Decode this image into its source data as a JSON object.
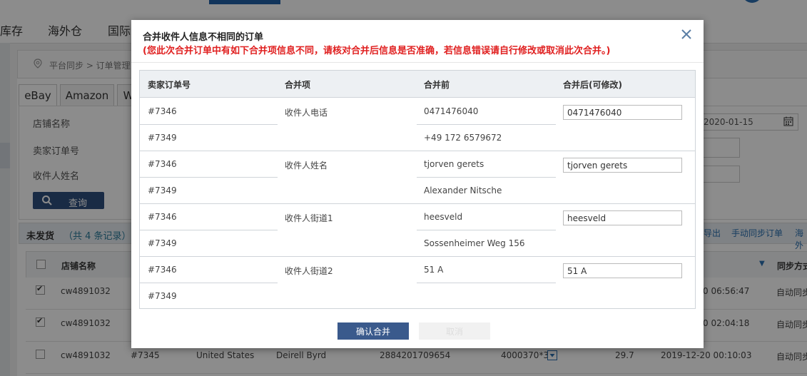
{
  "background": {
    "nav": [
      "库存",
      "海外仓",
      "国际"
    ],
    "breadcrumb": "平台同步 > 订单管理",
    "tabs": [
      "eBay",
      "Amazon",
      "W"
    ],
    "filters": [
      "店铺名称",
      "卖家订单号",
      "收件人姓名"
    ],
    "date_value": "2020-01-15",
    "search_label": "查询",
    "list_title": "未发货",
    "list_count": "（共 4 条记录）",
    "links": [
      "导出",
      "手动同步订单",
      "海外"
    ],
    "grid_headers": {
      "store": "店铺名称",
      "sync_method": "同步方式"
    },
    "rows": [
      {
        "checked": true,
        "store": "cw4891032",
        "time": "0 06:56:47",
        "sync": "自动同步"
      },
      {
        "checked": true,
        "store": "cw4891032",
        "time": "0 02:04:18",
        "sync": "自动同步"
      },
      {
        "checked": false,
        "store": "cw4891032",
        "order": "#7345",
        "country": "United States",
        "name": "Deirell Byrd",
        "phone": "2884201709654",
        "sku": "4000370*3",
        "amount": "29.7",
        "time": "2019-12-20 00:10:03",
        "sync": "自动同步"
      }
    ]
  },
  "modal": {
    "title": "合并收件人信息不相同的订单",
    "warning": "(您此次合并订单中有如下合并项信息不同，请核对合并后信息是否准确，若信息错误请自行修改或取消此次合并。)",
    "headers": [
      "卖家订单号",
      "合并项",
      "合并前",
      "合并后(可修改)"
    ],
    "groups": [
      {
        "orders": [
          "#7346",
          "#7349"
        ],
        "field": "收件人电话",
        "before": [
          "0471476040",
          "+49 172 6579672"
        ],
        "after": "0471476040"
      },
      {
        "orders": [
          "#7346",
          "#7349"
        ],
        "field": "收件人姓名",
        "before": [
          "tjorven gerets",
          "Alexander Nitsche"
        ],
        "after": "tjorven gerets"
      },
      {
        "orders": [
          "#7346",
          "#7349"
        ],
        "field": "收件人街道1",
        "before": [
          "heesveld",
          "Sossenheimer Weg 156"
        ],
        "after": "heesveld"
      },
      {
        "orders": [
          "#7346",
          "#7349"
        ],
        "field": "收件人街道2",
        "before": [
          "51 A",
          ""
        ],
        "after": "51 A"
      }
    ],
    "confirm_label": "确认合并",
    "cancel_label": "取消"
  }
}
